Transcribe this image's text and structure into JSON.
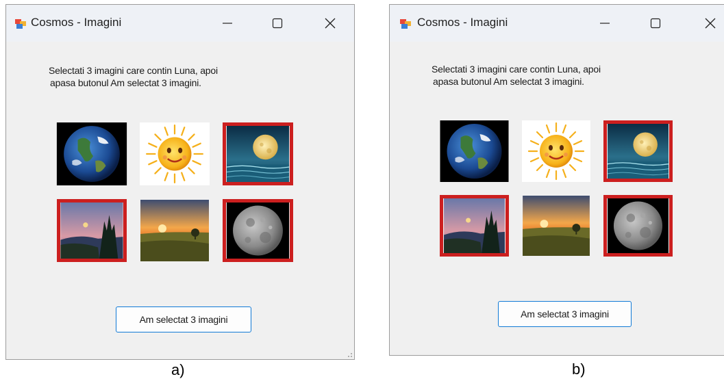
{
  "window_a": {
    "title": "Cosmos - Imagini",
    "instruction_line1": "Selectati 3 imagini care contin Luna, apoi",
    "instruction_line2": "apasa butonul Am selectat 3 imagini.",
    "button_label": "Am selectat 3 imagini",
    "images": [
      {
        "subject": "earth",
        "selected": false
      },
      {
        "subject": "sun",
        "selected": false
      },
      {
        "subject": "moon-over-sea",
        "selected": true
      },
      {
        "subject": "moon-over-forest",
        "selected": true
      },
      {
        "subject": "sunset-landscape",
        "selected": false
      },
      {
        "subject": "moon-surface",
        "selected": true
      }
    ]
  },
  "window_b": {
    "title": "Cosmos - Imagini",
    "instruction_line1": "Selectati 3 imagini care contin Luna, apoi",
    "instruction_line2": "apasa butonul Am selectat 3 imagini.",
    "button_label": "Am selectat 3 imagini",
    "images": [
      {
        "subject": "earth",
        "selected": false
      },
      {
        "subject": "sun",
        "selected": false
      },
      {
        "subject": "moon-over-sea",
        "selected": true
      },
      {
        "subject": "moon-over-forest",
        "selected": true
      },
      {
        "subject": "sunset-landscape",
        "selected": false
      },
      {
        "subject": "moon-surface",
        "selected": true
      }
    ]
  },
  "captions": {
    "a": "a)",
    "b": "b)"
  },
  "icons": {
    "app": "form-app-icon",
    "minimize": "minimize-icon",
    "maximize": "maximize-icon",
    "close": "close-icon"
  },
  "colors": {
    "selection_border": "#cc1f1f",
    "button_border": "#0f79d6"
  }
}
